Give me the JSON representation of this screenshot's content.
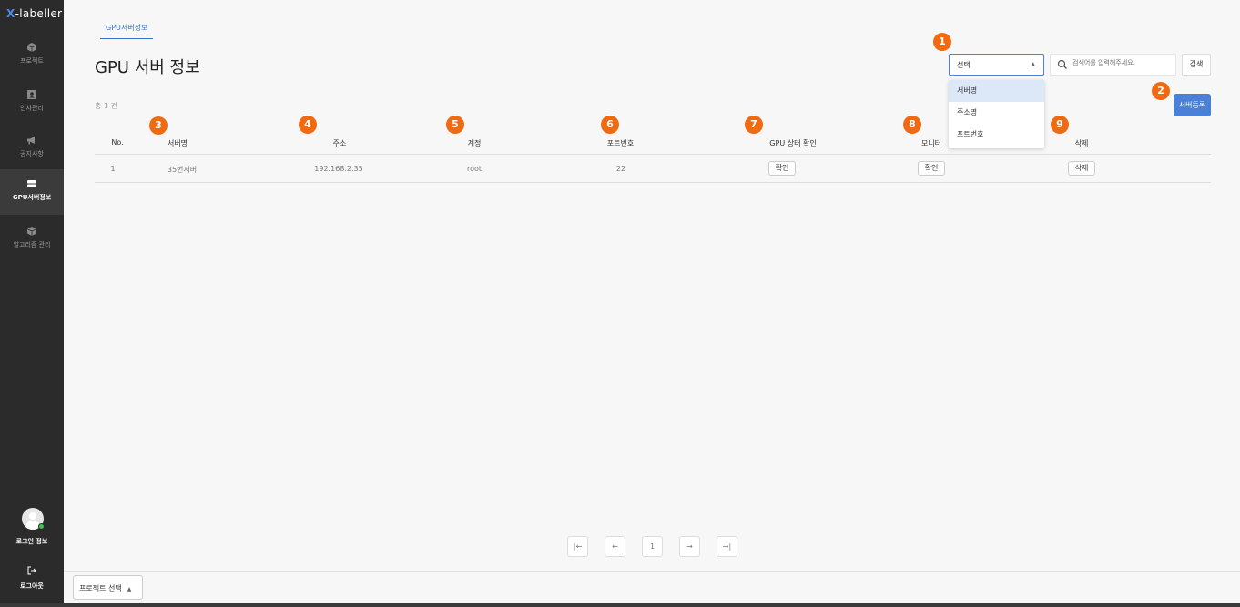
{
  "app": {
    "logo_prefix": "X",
    "logo_rest": "-labeller"
  },
  "sidebar": {
    "items": [
      {
        "label": "프로젝트",
        "icon": "cube-icon"
      },
      {
        "label": "인사관리",
        "icon": "id-card-icon"
      },
      {
        "label": "공지사항",
        "icon": "megaphone-icon"
      },
      {
        "label": "GPU서버정보",
        "icon": "server-icon",
        "active": true
      },
      {
        "label": "알고리즘 관리",
        "icon": "cube-icon"
      }
    ],
    "login_info": "로그인 정보",
    "logout": "로그아웃"
  },
  "tab": {
    "label": "GPU서버정보"
  },
  "page": {
    "title": "GPU 서버 정보",
    "total": "총 1 건"
  },
  "search": {
    "select_label": "선택",
    "options": [
      "서버명",
      "주소명",
      "포트번호"
    ],
    "placeholder": "검색어를 입력해주세요.",
    "button": "검색",
    "register": "서버등록"
  },
  "badges": [
    "1",
    "2",
    "3",
    "4",
    "5",
    "6",
    "7",
    "8",
    "9"
  ],
  "table": {
    "headers": [
      "No.",
      "서버명",
      "주소",
      "계정",
      "포트번호",
      "GPU 상태 확인",
      "모니터",
      "삭제"
    ],
    "rows": [
      {
        "no": "1",
        "name": "35번서버",
        "address": "192.168.2.35",
        "account": "root",
        "port": "22",
        "gpu_btn": "확인",
        "monitor_btn": "확인",
        "delete_btn": "삭제"
      }
    ]
  },
  "pagination": {
    "first": "|←",
    "prev": "←",
    "page": "1",
    "next": "→",
    "last": "→|"
  },
  "footer": {
    "project_select": "프로젝트 선택"
  },
  "colors": {
    "accent": "#4a80d8",
    "badge": "#f06a12",
    "sidebar": "#2b2b2b"
  }
}
